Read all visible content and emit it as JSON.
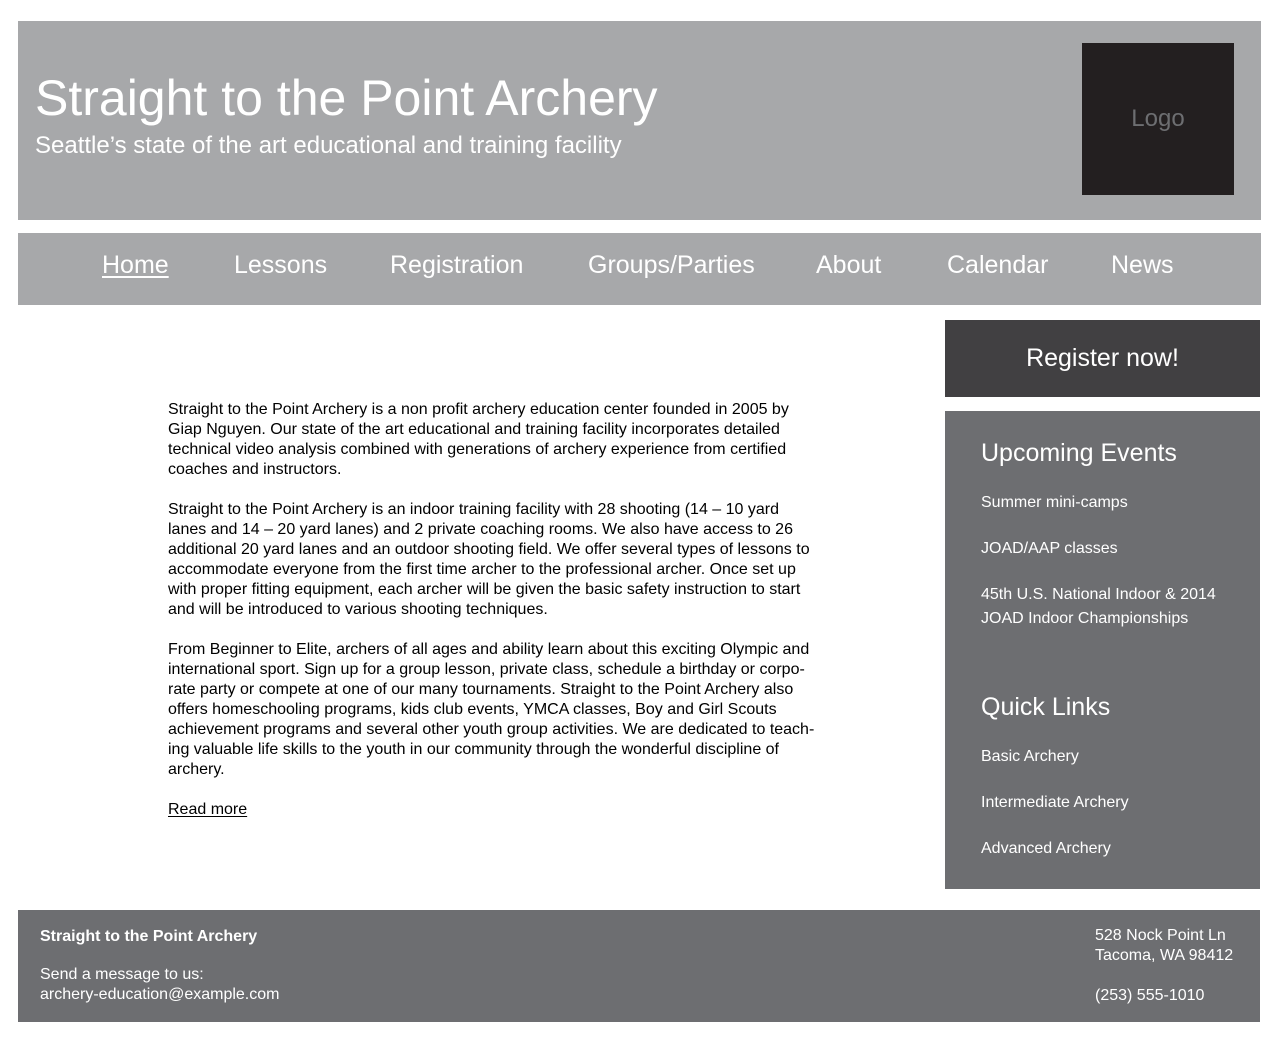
{
  "header": {
    "title": "Straight to the Point Archery",
    "subtitle": "Seattle’s state of the art educational and training facility",
    "logo_text": "Logo"
  },
  "nav": {
    "items": [
      "Home",
      "Lessons",
      "Registration",
      "Groups/Parties",
      "About",
      "Calendar",
      "News"
    ],
    "active": "Home"
  },
  "main": {
    "paragraphs": [
      "Straight to the Point Archery is a non profit archery education center founded in 2005 by Giap Nguyen. Our state of the art educational and training facility incorporates detailed technical video analysis combined with generations of archery experience from certified coaches and instructors.",
      "Straight to the Point Archery is an indoor training facility with 28 shooting (14 – 10 yard lanes and 14 – 20 yard lanes) and 2 private coaching rooms. We also have access to 26 additional 20 yard lanes  and an outdoor shooting field. We offer several types of lessons to accommodate everyone from the first time archer to the professional archer. Once set up with proper fitting equipment, each archer will be given the basic safety instruction to start and will be introduced to various shooting techniques.",
      "From Beginner to Elite, archers of all ages and ability learn about this exciting Olympic and international sport. Sign up for a group lesson, private class, schedule a birthday or corpo-rate party or compete at one of our many tournaments. Straight to the Point Archery also offers homeschooling programs, kids club events, YMCA classes, Boy and Girl Scouts achievement programs and several other youth group activities. We are dedicated to teach-ing valuable life skills to the youth in our community through the wonderful discipline of archery."
    ],
    "read_more": "Read more"
  },
  "sidebar": {
    "register_label": "Register now!",
    "events_heading": "Upcoming Events",
    "events": [
      "Summer mini-camps",
      "JOAD/AAP classes",
      "45th  U.S. National Indoor & 2014",
      "JOAD Indoor Championships"
    ],
    "links_heading": "Quick Links",
    "links": [
      "Basic Archery",
      "Intermediate Archery",
      "Advanced Archery"
    ]
  },
  "footer": {
    "name": "Straight to the Point Archery",
    "send_label": "Send a message to us:",
    "email": "archery-education@example.com",
    "address_line1": "528 Nock Point Ln",
    "address_line2": "Tacoma, WA 98412",
    "phone": "(253) 555-1010"
  },
  "colors": {
    "header_bg": "#a7a8aa",
    "logo_bg": "#231f20",
    "register_bg": "#414042",
    "sidebar_bg": "#6d6e71",
    "footer_bg": "#6d6e71"
  }
}
